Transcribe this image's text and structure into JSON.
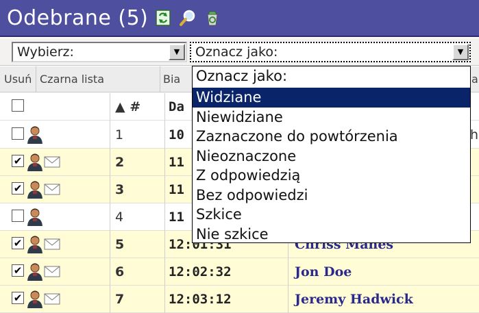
{
  "header": {
    "title": "Odebrane (5)",
    "icons": [
      "refresh-icon",
      "search-icon",
      "recycle-icon"
    ]
  },
  "toolbar": {
    "select_wybierz": "Wybierz:",
    "select_oznacz": "Oznacz jako:"
  },
  "actions": {
    "usun": "Usuń",
    "czarna": "Czarna lista",
    "bia": "Bia",
    "trailing": "a"
  },
  "table": {
    "header_sort": "▲ #",
    "header_time": "Da",
    "rows": [
      {
        "num": "1",
        "time": "10",
        "name": "",
        "checked": false,
        "mail": false,
        "unread": false,
        "trailing": "h"
      },
      {
        "num": "2",
        "time": "11",
        "name": "",
        "checked": true,
        "mail": true,
        "unread": true,
        "trailing": ""
      },
      {
        "num": "3",
        "time": "11",
        "name": "",
        "checked": true,
        "mail": true,
        "unread": true,
        "trailing": ""
      },
      {
        "num": "4",
        "time": "11",
        "name": "",
        "checked": false,
        "mail": false,
        "unread": false,
        "trailing": ""
      },
      {
        "num": "5",
        "time": "12:01:31",
        "name": "Chriss Manes",
        "checked": true,
        "mail": true,
        "unread": true,
        "trailing": ""
      },
      {
        "num": "6",
        "time": "12:02:32",
        "name": "Jon Doe",
        "checked": true,
        "mail": true,
        "unread": true,
        "trailing": ""
      },
      {
        "num": "7",
        "time": "12:03:12",
        "name": "Jeremy Hadwick",
        "checked": true,
        "mail": true,
        "unread": true,
        "trailing": ""
      }
    ]
  },
  "dropdown": {
    "items": [
      "Oznacz jako:",
      "Widziane",
      "Niewidziane",
      "Zaznaczone do powtórzenia",
      "Nieoznaczone",
      "Z odpowiedzią",
      "Bez odpowiedzi",
      "Szkice",
      "Nie szkice"
    ],
    "selected_index": 1
  },
  "colors": {
    "header_bg": "#4f4fa0",
    "unread_row": "#fffcd6",
    "selected_item": "#0a246a",
    "name_text": "#2a2a8c"
  }
}
